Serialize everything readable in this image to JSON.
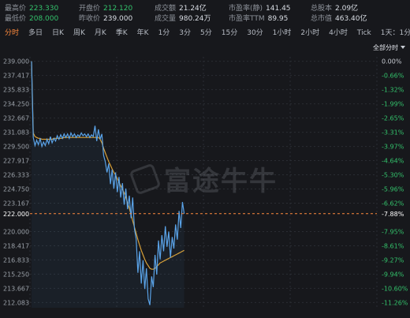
{
  "stats": [
    {
      "label": "最高价",
      "value": "223.330",
      "color": "up"
    },
    {
      "label": "最低价",
      "value": "208.000",
      "color": "up"
    },
    {
      "label": "开盘价",
      "value": "212.120",
      "color": "up"
    },
    {
      "label": "昨收价",
      "value": "239.000",
      "color": ""
    },
    {
      "label": "成交额",
      "value": "21.24亿",
      "color": ""
    },
    {
      "label": "成交量",
      "value": "980.24万",
      "color": ""
    },
    {
      "label": "市盈率(静)",
      "value": "141.45",
      "color": ""
    },
    {
      "label": "市盈率TTM",
      "value": "89.95",
      "color": ""
    },
    {
      "label": "总股本",
      "value": "2.09亿",
      "color": ""
    },
    {
      "label": "总市值",
      "value": "463.40亿",
      "color": ""
    }
  ],
  "tabs": [
    "分时",
    "多日",
    "日K",
    "周K",
    "月K",
    "季K",
    "年K",
    "1分",
    "3分",
    "5分",
    "15分",
    "30分",
    "1小时",
    "2小时",
    "4小时",
    "Tick",
    "1天：1分K"
  ],
  "active_tab": "分时",
  "toolbar": {
    "label": "全部分时"
  },
  "watermark": "富途牛牛",
  "chart_data": {
    "type": "line",
    "y_ticks": [
      "239.000",
      "237.417",
      "235.833",
      "234.250",
      "232.667",
      "231.083",
      "229.500",
      "227.917",
      "226.333",
      "224.750",
      "223.167",
      "222.000",
      "220.000",
      "218.417",
      "216.833",
      "215.250",
      "213.667",
      "212.083"
    ],
    "pct_ticks": [
      "0.00%",
      "-0.66%",
      "-1.32%",
      "-1.99%",
      "-2.65%",
      "-3.31%",
      "-3.97%",
      "-4.64%",
      "-5.30%",
      "-5.96%",
      "-6.62%",
      "-7.88%",
      "-7.95%",
      "-8.61%",
      "-9.27%",
      "-9.94%",
      "-10.60%",
      "-11.26%"
    ],
    "ylim": [
      211.5,
      239.5
    ],
    "current_price": "222.000",
    "current_pct": "-7.88%",
    "colors": {
      "price": "#5aa3e8",
      "avg": "#d8a13a",
      "current": "#ff8a3d",
      "grid": "#2a2d33"
    },
    "price": [
      239.0,
      230.5,
      229.6,
      230.2,
      229.7,
      230.4,
      229.5,
      230.0,
      229.6,
      230.3,
      229.8,
      230.6,
      229.9,
      230.4,
      230.1,
      230.7,
      230.3,
      230.8,
      230.4,
      230.9,
      230.5,
      230.9,
      230.4,
      231.0,
      230.6,
      230.9,
      230.5,
      230.8,
      230.6,
      231.0,
      230.7,
      230.9,
      230.6,
      230.9,
      230.5,
      230.8,
      230.6,
      231.8,
      230.1,
      231.4,
      230.3,
      230.9,
      228.5,
      227.8,
      226.6,
      227.6,
      225.3,
      226.9,
      224.8,
      226.6,
      224.4,
      226.1,
      223.8,
      225.4,
      223.0,
      224.8,
      222.5,
      224.0,
      221.5,
      223.8,
      220.3,
      219.2,
      215.4,
      217.8,
      214.2,
      216.8,
      213.6,
      215.9,
      212.5,
      211.8,
      215.0,
      213.8,
      217.4,
      215.2,
      219.0,
      216.9,
      219.6,
      217.8,
      220.6,
      218.3,
      220.0,
      217.1,
      219.4,
      218.1,
      220.8,
      219.1,
      222.3,
      220.4,
      223.3,
      222.0
    ],
    "avg": [
      239.0,
      231.0,
      230.6,
      230.5,
      230.4,
      230.4,
      230.3,
      230.3,
      230.3,
      230.3,
      230.3,
      230.3,
      230.3,
      230.4,
      230.4,
      230.4,
      230.4,
      230.4,
      230.4,
      230.5,
      230.5,
      230.5,
      230.5,
      230.5,
      230.5,
      230.5,
      230.5,
      230.5,
      230.5,
      230.5,
      230.5,
      230.5,
      230.5,
      230.5,
      230.5,
      230.5,
      230.5,
      230.5,
      230.5,
      230.5,
      230.3,
      229.9,
      229.3,
      228.8,
      228.3,
      227.8,
      227.4,
      227.0,
      226.6,
      226.3,
      225.9,
      225.5,
      225.1,
      224.7,
      224.3,
      223.8,
      223.2,
      222.6,
      221.9,
      221.2,
      220.5,
      219.8,
      219.1,
      218.5,
      217.9,
      217.4,
      216.9,
      216.5,
      216.2,
      215.9,
      215.8,
      215.8,
      215.9,
      216.1,
      216.3,
      216.5,
      216.6,
      216.7,
      216.8,
      216.9,
      217.0,
      217.1,
      217.2,
      217.3,
      217.4,
      217.5,
      217.6,
      217.7,
      217.8,
      217.9
    ]
  }
}
